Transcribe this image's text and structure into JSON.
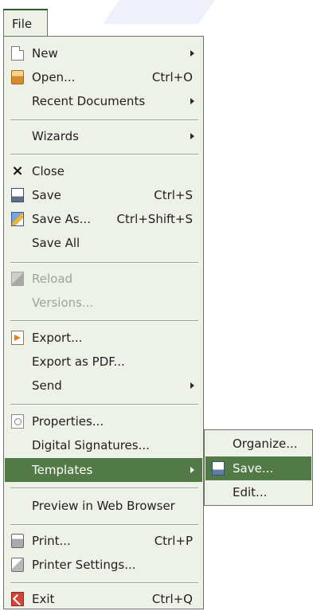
{
  "menubar": {
    "file": "File"
  },
  "menu": {
    "items": [
      {
        "label": "New",
        "shortcut": "",
        "submenu": true
      },
      {
        "label": "Open...",
        "shortcut": "Ctrl+O",
        "submenu": false
      },
      {
        "label": "Recent Documents",
        "shortcut": "",
        "submenu": true
      },
      {
        "label": "Wizards",
        "shortcut": "",
        "submenu": true
      },
      {
        "label": "Close",
        "shortcut": "",
        "submenu": false
      },
      {
        "label": "Save",
        "shortcut": "Ctrl+S",
        "submenu": false
      },
      {
        "label": "Save As...",
        "shortcut": "Ctrl+Shift+S",
        "submenu": false
      },
      {
        "label": "Save All",
        "shortcut": "",
        "submenu": false
      },
      {
        "label": "Reload",
        "shortcut": "",
        "submenu": false,
        "disabled": true
      },
      {
        "label": "Versions...",
        "shortcut": "",
        "submenu": false,
        "disabled": true
      },
      {
        "label": "Export...",
        "shortcut": "",
        "submenu": false
      },
      {
        "label": "Export as PDF...",
        "shortcut": "",
        "submenu": false
      },
      {
        "label": "Send",
        "shortcut": "",
        "submenu": true
      },
      {
        "label": "Properties...",
        "shortcut": "",
        "submenu": false
      },
      {
        "label": "Digital Signatures...",
        "shortcut": "",
        "submenu": false
      },
      {
        "label": "Templates",
        "shortcut": "",
        "submenu": true,
        "highlighted": true
      },
      {
        "label": "Preview in Web Browser",
        "shortcut": "",
        "submenu": false
      },
      {
        "label": "Print...",
        "shortcut": "Ctrl+P",
        "submenu": false
      },
      {
        "label": "Printer Settings...",
        "shortcut": "",
        "submenu": false
      },
      {
        "label": "Exit",
        "shortcut": "Ctrl+Q",
        "submenu": false
      }
    ]
  },
  "templates_submenu": {
    "items": [
      {
        "label": "Organize..."
      },
      {
        "label": "Save...",
        "highlighted": true
      },
      {
        "label": "Edit..."
      }
    ]
  },
  "colors": {
    "menu_background": "#eef1e8",
    "highlight": "#527a46",
    "border": "#6d7466",
    "text": "#1f1f1f",
    "disabled_text": "#9ea39a"
  },
  "icons": {
    "new": "document-icon",
    "open": "folder-open-icon",
    "close": "close-icon",
    "save": "floppy-disk-icon",
    "save_as": "save-as-icon",
    "reload": "reload-icon",
    "export": "export-icon",
    "properties": "properties-icon",
    "print": "printer-icon",
    "printer_settings": "printer-settings-icon",
    "exit": "exit-icon",
    "template_save": "template-save-icon"
  }
}
